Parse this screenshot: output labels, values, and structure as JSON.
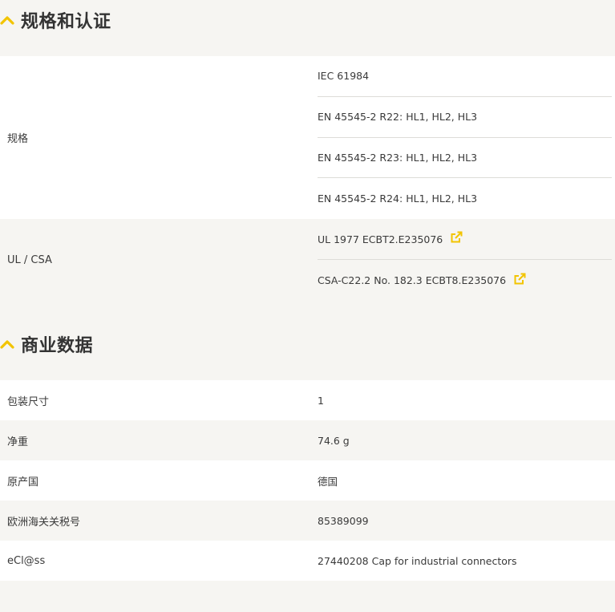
{
  "spec_section": {
    "title": "规格和认证",
    "rows": [
      {
        "label": "规格",
        "values": [
          "IEC 61984",
          "EN 45545-2 R22: HL1, HL2, HL3",
          "EN 45545-2 R23: HL1, HL2, HL3",
          "EN 45545-2 R24: HL1, HL2, HL3"
        ]
      },
      {
        "label": "UL / CSA",
        "values": [
          "UL 1977 ECBT2.E235076",
          "CSA-C22.2 No. 182.3 ECBT8.E235076"
        ]
      }
    ]
  },
  "commercial_section": {
    "title": "商业数据",
    "rows": [
      {
        "label": "包装尺寸",
        "value": "1"
      },
      {
        "label": "净重",
        "value": "74.6 g"
      },
      {
        "label": "原产国",
        "value": "德国"
      },
      {
        "label": "欧洲海关关税号",
        "value": "85389099"
      },
      {
        "label": "eCl@ss",
        "value": "27440208 Cap for industrial connectors"
      }
    ]
  },
  "colors": {
    "accent": "#f2c400",
    "background": "#f6f5f2",
    "row_white": "#ffffff",
    "text": "#3a3a3a"
  },
  "icons": {
    "collapse": "chevron-up-icon",
    "external": "external-link-icon"
  }
}
